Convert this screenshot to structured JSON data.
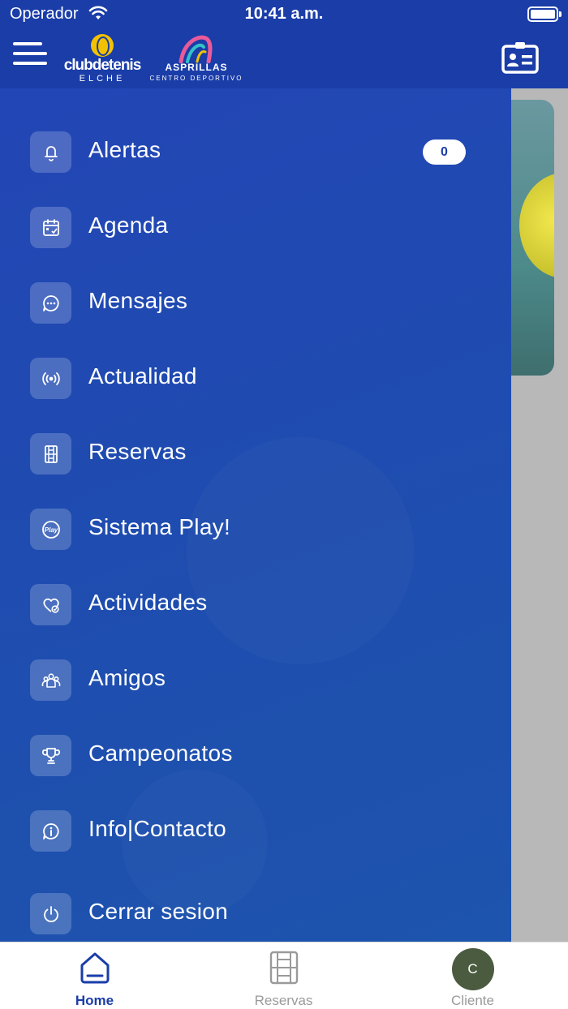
{
  "status_bar": {
    "carrier": "Operador",
    "time": "10:41 a.m."
  },
  "header": {
    "logo_primary": {
      "name": "clubdetenis",
      "city": "ELCHE"
    },
    "logo_secondary": {
      "name": "ASPRILLAS",
      "sub": "CENTRO DEPORTIVO"
    }
  },
  "drawer": {
    "items": [
      {
        "label": "Alertas",
        "icon": "bell-icon",
        "badge": "0"
      },
      {
        "label": "Agenda",
        "icon": "calendar-icon"
      },
      {
        "label": "Mensajes",
        "icon": "chat-icon"
      },
      {
        "label": "Actualidad",
        "icon": "broadcast-icon"
      },
      {
        "label": "Reservas",
        "icon": "court-icon"
      },
      {
        "label": "Sistema Play!",
        "icon": "play-icon"
      },
      {
        "label": "Actividades",
        "icon": "heart-check-icon"
      },
      {
        "label": "Amigos",
        "icon": "group-icon"
      },
      {
        "label": "Campeonatos",
        "icon": "trophy-icon"
      },
      {
        "label": "Info|Contacto",
        "icon": "info-icon"
      },
      {
        "label": "Cerrar sesion",
        "icon": "power-icon"
      }
    ]
  },
  "tabbar": {
    "tabs": [
      {
        "label": "Home",
        "icon": "home-icon",
        "active": true
      },
      {
        "label": "Reservas",
        "icon": "court-icon",
        "active": false
      },
      {
        "label": "Cliente",
        "icon": "avatar",
        "initial": "C",
        "active": false
      }
    ]
  },
  "colors": {
    "brand": "#1a3da8",
    "drawer": "#1f4bb0",
    "avatar": "#4b5b3f"
  }
}
